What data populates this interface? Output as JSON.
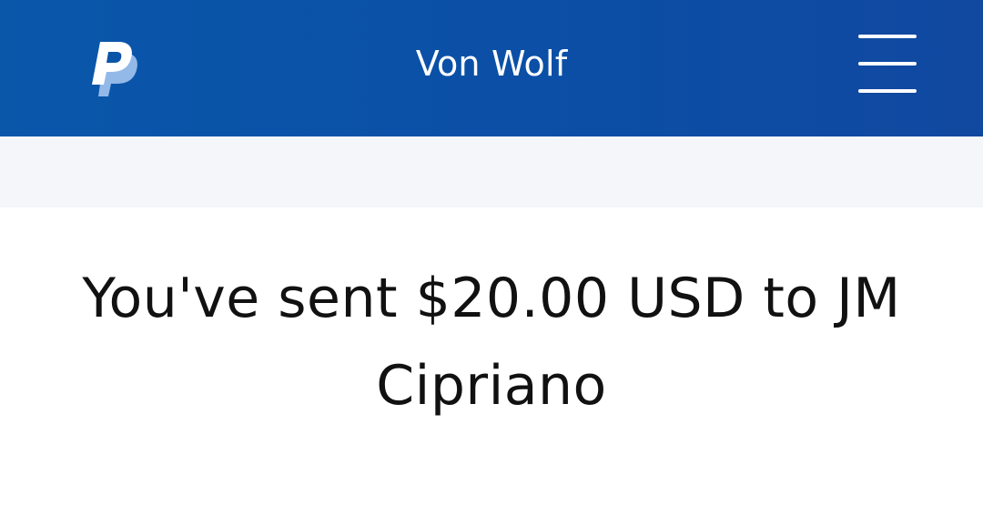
{
  "header": {
    "title": "Von Wolf",
    "logo_icon": "paypal-logo-icon",
    "menu_icon": "hamburger-menu-icon",
    "background_color": "#0b51a6"
  },
  "main": {
    "confirmation_message": "You've sent $20.00 USD to JM Cipriano",
    "band_color": "#f5f6fa"
  }
}
